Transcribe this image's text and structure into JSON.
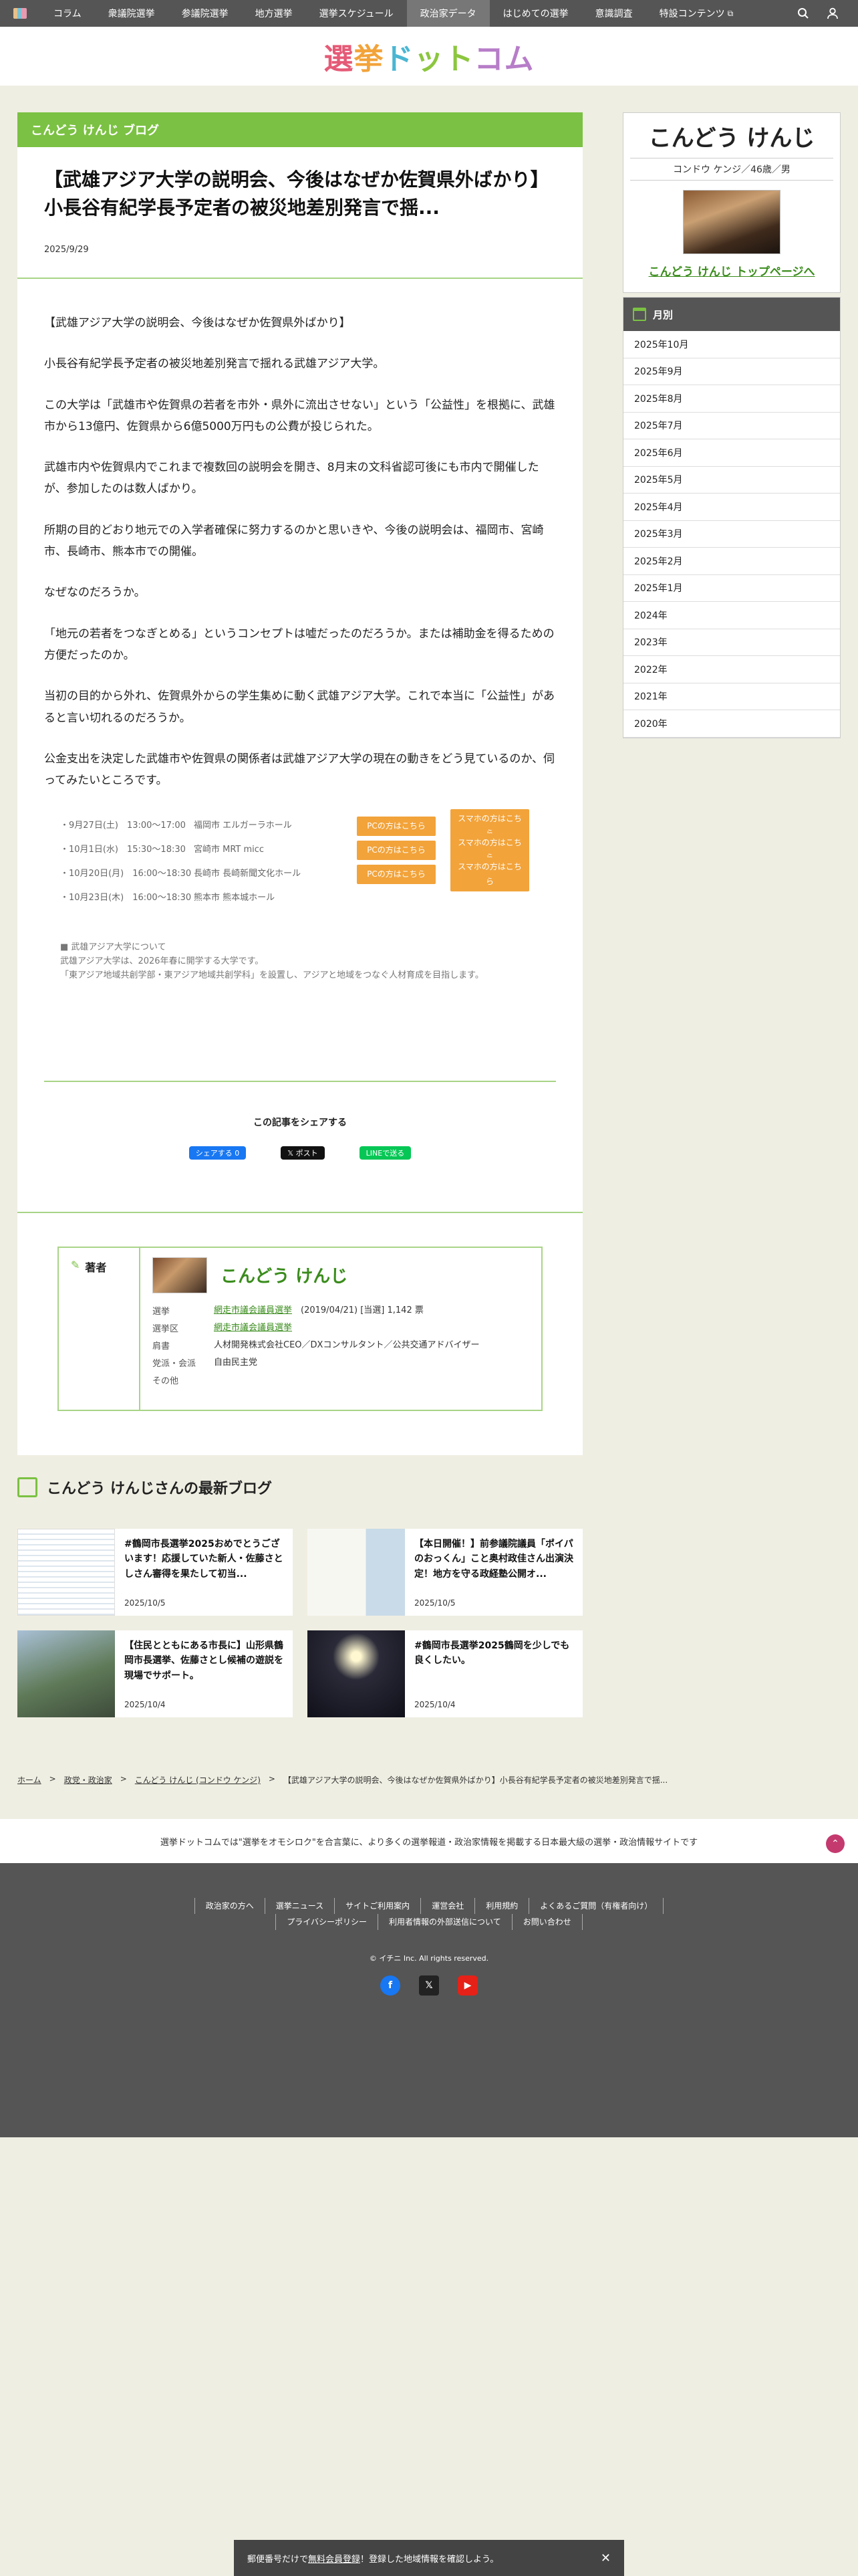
{
  "nav": {
    "items": [
      "コラム",
      "衆議院選挙",
      "参議院選挙",
      "地方選挙",
      "選挙スケジュール",
      "政治家データ",
      "はじめての選挙",
      "意識調査",
      "特設コンテンツ"
    ],
    "active_index": 5
  },
  "site": {
    "logo": [
      "選",
      "挙",
      "ド",
      "ット",
      "コム"
    ]
  },
  "article": {
    "label": "こんどう けんじ ブログ",
    "title": "【武雄アジア大学の説明会、今後はなぜか佐賀県外ばかり】小長谷有紀学長予定者の被災地差別発言で揺...",
    "date": "2025/9/29",
    "paragraphs": [
      "【武雄アジア大学の説明会、今後はなぜか佐賀県外ばかり】",
      "小長谷有紀学長予定者の被災地差別発言で揺れる武雄アジア大学。",
      "この大学は「武雄市や佐賀県の若者を市外・県外に流出させない」という「公益性」を根拠に、武雄市から13億円、佐賀県から6億5000万円もの公費が投じられた。",
      "武雄市内や佐賀県内でこれまで複数回の説明会を開き、8月末の文科省認可後にも市内で開催したが、参加したのは数人ばかり。",
      "所期の目的どおり地元での入学者確保に努力するのかと思いきや、今後の説明会は、福岡市、宮崎市、長崎市、熊本市での開催。",
      "なぜなのだろうか。",
      "「地元の若者をつなぎとめる」というコンセプトは嘘だったのだろうか。または補助金を得るための方便だったのか。",
      "当初の目的から外れ、佐賀県外からの学生集めに動く武雄アジア大学。これで本当に「公益性」があると言い切れるのだろうか。",
      "公金支出を決定した武雄市や佐賀県の関係者は武雄アジア大学の現在の動きをどう見ているのか、伺ってみたいところです。"
    ],
    "events": [
      {
        "date": "・9月27日(土)　13:00〜17:00",
        "place": "福岡市 エルガーラホール",
        "pc": "PCの方はこちら",
        "sp": "スマホの方はこちら"
      },
      {
        "date": "・10月1日(水)　15:30〜18:30",
        "place": "宮崎市 MRT micc",
        "pc": "PCの方はこちら",
        "sp": "スマホの方はこちら"
      },
      {
        "date": "・10月20日(月)　16:00〜18:30",
        "place": "長崎市 長崎新聞文化ホール",
        "pc": "PCの方はこちら",
        "sp": "スマホの方はこちら"
      },
      {
        "date": "・10月23日(木)　16:00〜18:30",
        "place": "熊本市 熊本城ホール",
        "pc": "",
        "sp": ""
      }
    ],
    "note": [
      "■ 武雄アジア大学について",
      "武雄アジア大学は、2026年春に開学する大学です。",
      "「東アジア地域共創学部・東アジア地域共創学科」を設置し、アジアと地域をつなぐ人材育成を目指します。"
    ],
    "share_title": "この記事をシェアする",
    "share": {
      "fb": "シェアする 0",
      "x": "𝕏 ポスト",
      "line": "LINEで送る"
    }
  },
  "author": {
    "tag": "著者",
    "name": "こんどう けんじ",
    "rows": [
      {
        "k": "選挙",
        "link": "網走市議会議員選挙",
        "v": "(2019/04/21) [当選] 1,142 票"
      },
      {
        "k": "選挙区",
        "link": "網走市議会議員選挙",
        "v": ""
      },
      {
        "k": "肩書",
        "link": "",
        "v": "人材開発株式会社CEO／DXコンサルタント／公共交通アドバイザー"
      },
      {
        "k": "党派・会派",
        "link": "",
        "v": "自由民主党"
      },
      {
        "k": "その他",
        "link": "",
        "v": ""
      }
    ]
  },
  "sidebar": {
    "name": "こんどう けんじ",
    "sub": "コンドウ ケンジ／46歳／男",
    "top_link": "こんどう けんじ トップページへ",
    "month_title": "月別",
    "months": [
      "2025年10月",
      "2025年9月",
      "2025年8月",
      "2025年7月",
      "2025年6月",
      "2025年5月",
      "2025年4月",
      "2025年3月",
      "2025年2月",
      "2025年1月",
      "2024年",
      "2023年",
      "2022年",
      "2021年",
      "2020年"
    ]
  },
  "latest": {
    "title": "こんどう けんじさんの最新ブログ",
    "cards": [
      {
        "title": "#鶴岡市長選挙2025おめでとうございます！応援していた新人・佐藤さとしさん審得を果たして初当...",
        "date": "2025/10/5"
      },
      {
        "title": "【本日開催！】前参議院議員「ポイパのおっくん」こと奥村政佳さん出演決定！地方を守る政経塾公開オ...",
        "date": "2025/10/5"
      },
      {
        "title": "【住民とともにある市長に】山形県鶴岡市長選挙、佐藤さとし候補の遊説を現場でサポート。",
        "date": "2025/10/4"
      },
      {
        "title": "#鶴岡市長選挙2025鶴岡を少しでも良くしたい。",
        "date": "2025/10/4"
      }
    ]
  },
  "breadcrumb": [
    "ホーム",
    "政党・政治家",
    "こんどう けんじ (コンドウ ケンジ)",
    "【武雄アジア大学の説明会、今後はなぜか佐賀県外ばかり】小長谷有紀学長予定者の被災地差別発言で揺..."
  ],
  "tagline": "選挙ドットコムでは\"選挙をオモシロク\"を合言葉に、より多くの選挙報道・政治家情報を掲載する日本最大級の選挙・政治情報サイトです",
  "footer": {
    "row1": [
      "政治家の方へ",
      "選挙ニュース",
      "サイトご利用案内",
      "運営会社",
      "利用規約",
      "よくあるご質問（有権者向け）"
    ],
    "row2": [
      "プライバシーポリシー",
      "利用者情報の外部送信について",
      "お問い合わせ"
    ],
    "copyright": "© イチニ Inc. All rights reserved."
  },
  "bottom_bar": {
    "pre": "郵便番号だけで",
    "link": "無料会員登録",
    "post": "！登録した地域情報を確認しよう。",
    "close": "✕"
  }
}
